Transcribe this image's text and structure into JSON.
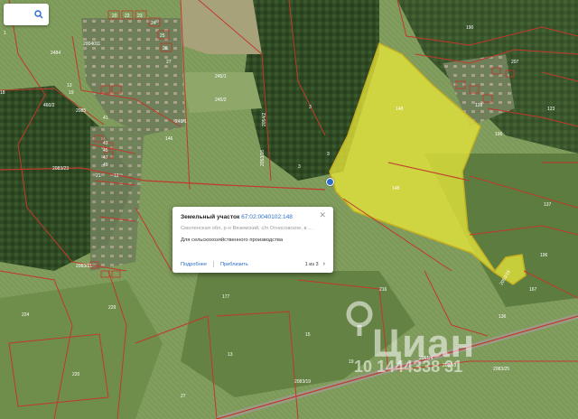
{
  "search": {
    "icon": "search-icon"
  },
  "popup": {
    "type_label": "Земельный участок",
    "cadastral_number": "67:02:0040102:148",
    "address": "Смоленская обл, р-н Вяземский, с/п Относовское, в ...",
    "purpose": "Для сельскохозяйственного производства",
    "details_link": "Подробнее",
    "zoom_link": "Приблизить",
    "pager": "1 из 3",
    "next_icon": "chevron-right-icon",
    "close_icon": "close-icon"
  },
  "watermark": {
    "brand": "Циан",
    "code": "10 1444338 31"
  },
  "highlight_color": "#e6e63a",
  "parcel_border_color": "#c0392b",
  "map_labels": [
    "2484",
    "1",
    "2004011",
    "20",
    "22",
    "23",
    "24",
    "25",
    "26",
    "27",
    "19",
    "460/2",
    "18",
    "13",
    "2085",
    "2083/23",
    "2083/21",
    "224",
    "229",
    "220",
    "249/1",
    "245/1",
    "245/2",
    "3",
    "3",
    "146",
    "148",
    "148",
    "2053/16",
    "2054/2",
    "3",
    "190",
    "207",
    "123",
    "128",
    "196",
    "137",
    "196",
    "2053/16",
    "167",
    "136",
    "216",
    "15",
    "2083/19",
    "2083/25",
    "13",
    "27",
    "177",
    "162",
    "41",
    "43",
    "45",
    "47",
    "49",
    "21",
    "12",
    "2051/4",
    "2083/3",
    "19"
  ]
}
